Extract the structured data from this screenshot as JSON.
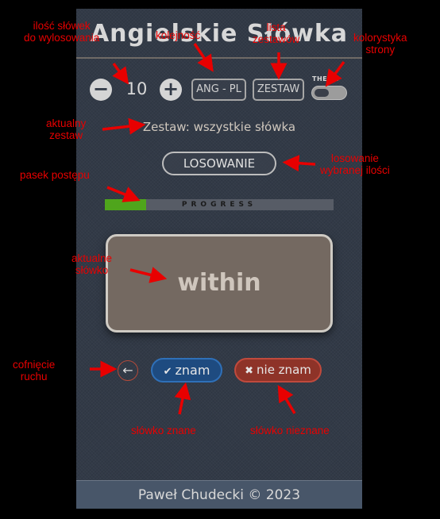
{
  "app": {
    "title": "Angielskie Słówka",
    "count": "10",
    "decrement_icon": "−",
    "increment_icon": "+",
    "direction_label": "ANG - PL",
    "sets_label": "ZESTAW",
    "theme_label": "THEME",
    "current_set": "Zestaw: wszystkie słówka",
    "draw_label": "LOSOWANIE",
    "progress_label": "PROGRESS",
    "progress_value": 0.18,
    "word": "within",
    "undo_icon": "←",
    "know_icon": "✔",
    "know_label": "znam",
    "dontknow_icon": "✖",
    "dontknow_label": "nie znam",
    "footer": "Paweł Chudecki © 2023"
  },
  "annotations": {
    "word_count": "ilość słówek\ndo wylosowania",
    "direction": "kolejność",
    "sets_list": "lista\nzestawów",
    "color_scheme": "kolorystyka\nstrony",
    "current_set": "aktualny\nzestaw",
    "draw": "losowanie\nwybranej ilości",
    "progress_bar": "pasek postępu",
    "current_word": "aktualne\nsłówko",
    "undo": "cofnięcie\nruchu",
    "word_known": "słówko znane",
    "word_unknown": "słówko nieznane"
  },
  "colors": {
    "annotation": "#e80000",
    "progress_fill": "#4fa51c",
    "know_button": "#1e4b80",
    "dontknow_button": "#8e3328"
  }
}
